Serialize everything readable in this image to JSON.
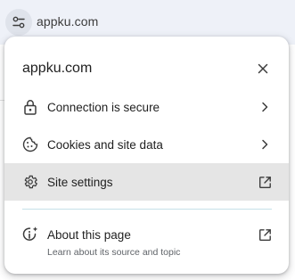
{
  "omnibox": {
    "url": "appku.com",
    "site_icon": "tune-icon"
  },
  "popup": {
    "title": "appku.com",
    "close_icon": "close-icon",
    "items": [
      {
        "label": "Connection is secure",
        "icon": "lock-icon",
        "trailing": "chevron-right-icon"
      },
      {
        "label": "Cookies and site data",
        "icon": "cookie-icon",
        "trailing": "chevron-right-icon"
      },
      {
        "label": "Site settings",
        "icon": "gear-icon",
        "trailing": "open-in-new-icon",
        "highlighted": true
      }
    ],
    "about": {
      "label": "About this page",
      "sublabel": "Learn about its source and topic",
      "icon": "info-sparkle-icon",
      "trailing": "open-in-new-icon"
    }
  },
  "colors": {
    "omnibox_bg": "#eef1f8",
    "highlight": "#e5e5e5",
    "divider": "#c6e0e8",
    "text": "#1f1f1f",
    "secondary_text": "#5f6368"
  }
}
